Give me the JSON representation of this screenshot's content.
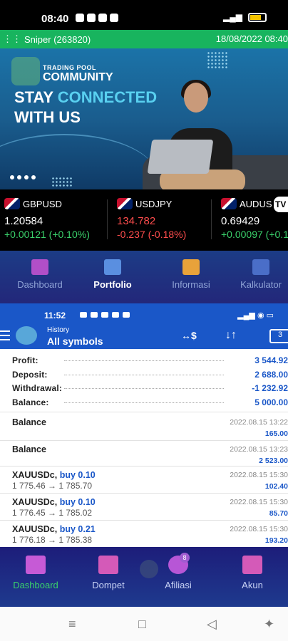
{
  "status": {
    "time": "08:40"
  },
  "account": {
    "name": "Sniper (263820)",
    "date": "18/08/2022 08:40"
  },
  "banner": {
    "brand_small": "TRADING POOL",
    "brand_big": "COMMUNITY",
    "line1_a": "STAY ",
    "line1_b": "CONNECTED",
    "line2": "WITH US"
  },
  "tickers": [
    {
      "symbol": "GBPUSD",
      "price": "1.20584",
      "change": "+0.00121 (+0.10%)",
      "dir": "up"
    },
    {
      "symbol": "USDJPY",
      "price": "134.782",
      "change": "-0.237 (-0.18%)",
      "dir": "down"
    },
    {
      "symbol": "AUDUS",
      "price": "0.69429",
      "change": "+0.00097 (+0.1",
      "dir": "up"
    }
  ],
  "ticker_badge": "TV",
  "top_nav": [
    {
      "label": "Dashboard",
      "icon": "chart-icon",
      "active": false
    },
    {
      "label": "Portfolio",
      "icon": "calendar-icon",
      "active": true
    },
    {
      "label": "Informasi",
      "icon": "people-icon",
      "active": false
    },
    {
      "label": "Kalkulator",
      "icon": "calculator-icon",
      "active": false
    }
  ],
  "inner_status": {
    "time": "11:52"
  },
  "history": {
    "subtitle": "History",
    "title": "All symbols",
    "action1": "↔$",
    "action2": "↓↑",
    "action3": "3"
  },
  "summary": [
    {
      "label": "Profit:",
      "value": "3 544.92"
    },
    {
      "label": "Deposit:",
      "value": "2 688.00"
    },
    {
      "label": "Withdrawal:",
      "value": "-1 232.92"
    },
    {
      "label": "Balance:",
      "value": "5 000.00"
    }
  ],
  "deals": [
    {
      "name": "Balance",
      "type": "",
      "prices": "",
      "date": "2022.08.15 13:22",
      "amount": "165.00"
    },
    {
      "name": "Balance",
      "type": "",
      "prices": "",
      "date": "2022.08.15 13:23",
      "amount": "2 523.00"
    },
    {
      "name": "XAUUSDc,",
      "type": "buy 0.10",
      "prices": "1 775.46 → 1 785.70",
      "date": "2022.08.15 15:30",
      "amount": "102.40"
    },
    {
      "name": "XAUUSDc,",
      "type": "buy 0.10",
      "prices": "1 776.45 → 1 785.02",
      "date": "2022.08.15 15:30",
      "amount": "85.70"
    },
    {
      "name": "XAUUSDc,",
      "type": "buy 0.21",
      "prices": "1 776.18 → 1 785.38",
      "date": "2022.08.15 15:30",
      "amount": "193.20"
    }
  ],
  "bottom_nav": [
    {
      "label": "Dashboard",
      "icon": "chart-icon",
      "active": true
    },
    {
      "label": "Dompet",
      "icon": "wallet-icon",
      "active": false
    },
    {
      "label": "Afiliasi",
      "icon": "phone-icon",
      "active": false,
      "badge": "8"
    },
    {
      "label": "Akun",
      "icon": "user-icon",
      "active": false
    }
  ],
  "colors": {
    "green": "#18b45e",
    "blue": "#1a57c8",
    "up": "#3ad16b",
    "down": "#ff4d4d",
    "nav": "#23277a"
  }
}
